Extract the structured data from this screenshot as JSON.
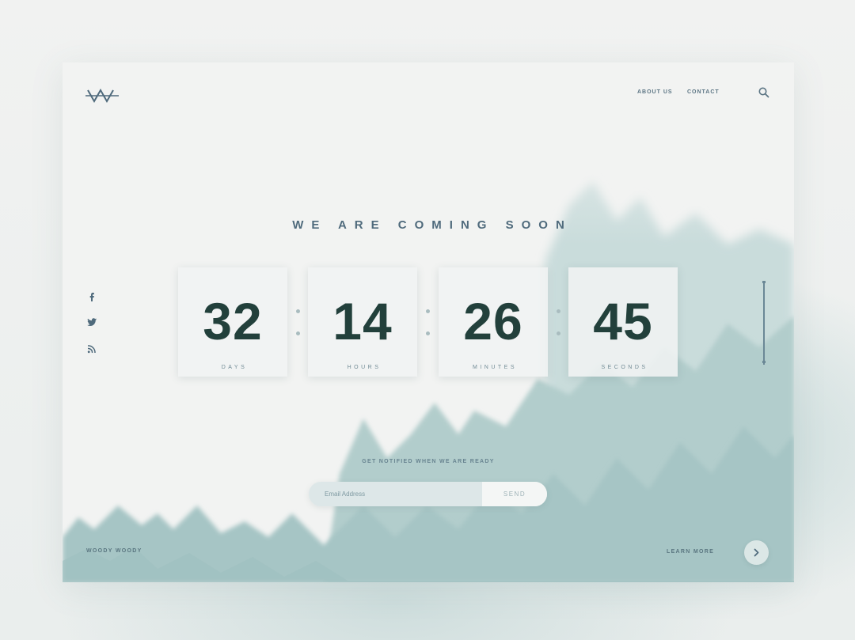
{
  "header": {
    "nav": [
      {
        "label": "ABOUT US"
      },
      {
        "label": "CONTACT"
      }
    ]
  },
  "hero": {
    "headline": "WE ARE COMING SOON"
  },
  "countdown": [
    {
      "value": "32",
      "label": "DAYS"
    },
    {
      "value": "14",
      "label": "HOURS"
    },
    {
      "value": "26",
      "label": "MINUTES"
    },
    {
      "value": "45",
      "label": "SECONDS"
    }
  ],
  "social": [
    "facebook-icon",
    "twitter-icon",
    "rss-icon"
  ],
  "subscribe": {
    "prompt": "GET NOTIFIED WHEN WE ARE READY",
    "placeholder": "Email Address",
    "button": "SEND"
  },
  "footer": {
    "brand": "WOODY WOODY",
    "learn_more": "LEARN MORE"
  },
  "colors": {
    "accent": "#22403b",
    "text_muted": "#5c7584",
    "mist": "#9fc3c3"
  }
}
